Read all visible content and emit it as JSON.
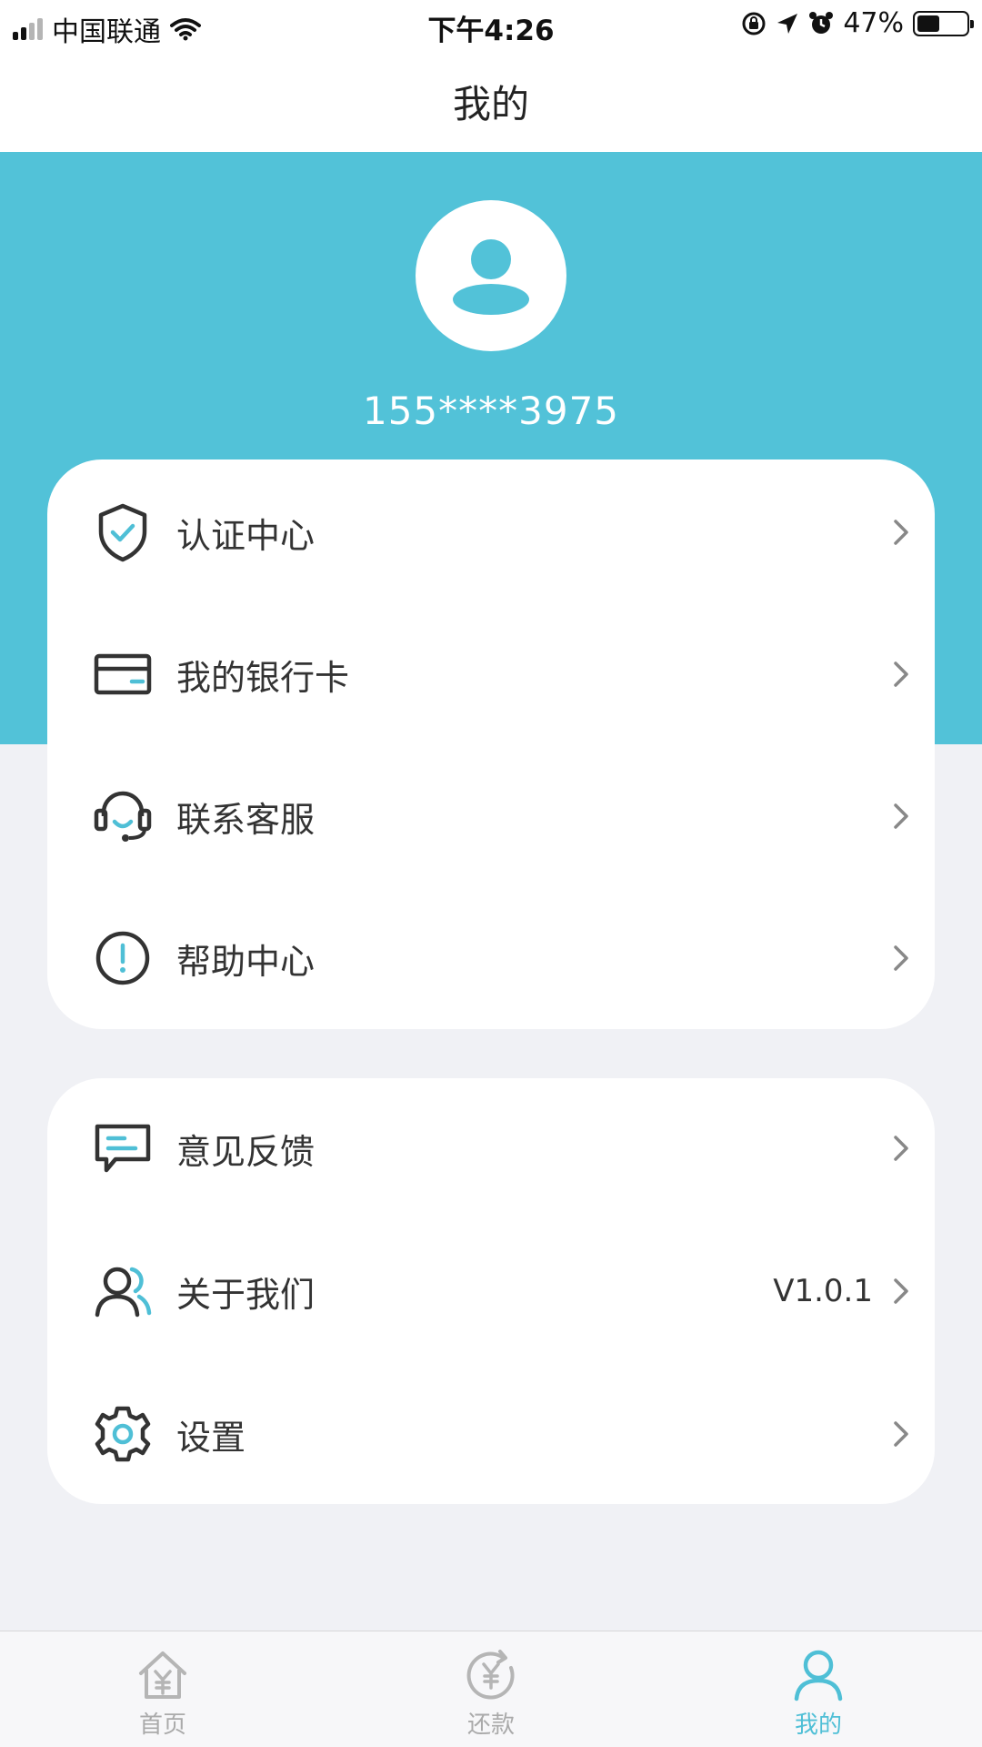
{
  "status_bar": {
    "carrier": "中国联通",
    "time": "下午4:26",
    "battery": "47%",
    "battery_level": 0.47
  },
  "nav": {
    "title": "我的"
  },
  "profile": {
    "phone": "155****3975"
  },
  "colors": {
    "accent": "#52c2d8",
    "tab_active": "#4fbfd6",
    "background": "#f0f1f5"
  },
  "menu_group_1": [
    {
      "label": "认证中心",
      "icon": "shield-check-icon"
    },
    {
      "label": "我的银行卡",
      "icon": "bank-card-icon"
    },
    {
      "label": "联系客服",
      "icon": "headset-icon"
    },
    {
      "label": "帮助中心",
      "icon": "info-circle-icon"
    }
  ],
  "menu_group_2": [
    {
      "label": "意见反馈",
      "icon": "feedback-icon"
    },
    {
      "label": "关于我们",
      "icon": "about-us-icon",
      "extra": "V1.0.1"
    },
    {
      "label": "设置",
      "icon": "gear-icon"
    }
  ],
  "tabs": [
    {
      "label": "首页",
      "icon": "home-yen-icon",
      "active": false
    },
    {
      "label": "还款",
      "icon": "repay-yen-icon",
      "active": false
    },
    {
      "label": "我的",
      "icon": "user-icon",
      "active": true
    }
  ]
}
